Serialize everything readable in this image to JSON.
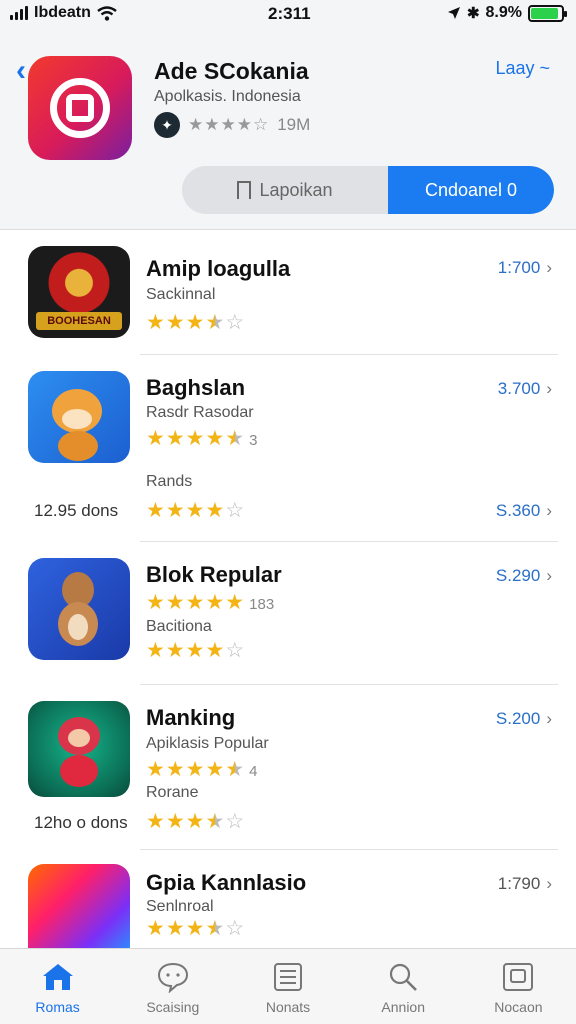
{
  "status": {
    "carrier": "Ibdeatn",
    "time": "2:311",
    "battery": "8.9%",
    "battery_level": 0.9
  },
  "header": {
    "app_name": "Ade SCokania",
    "subtitle": "Apolkasis. Indonesia",
    "size": "19M",
    "language_link": "Laay ~",
    "report_label": "Lapoikan",
    "download_label": "Cndoanel 0"
  },
  "apps": [
    {
      "name": "Amip loagulla",
      "sub": "Sackinnal",
      "rating": 3.5,
      "count": "",
      "price": "1:700"
    },
    {
      "name": "Baghslan",
      "sub": "Rasdr Rasodar",
      "rating": 4.5,
      "count": "3",
      "price": "3.700"
    },
    {
      "name": "",
      "sub": "Rands",
      "rating": 4,
      "count": "",
      "price": "S.360",
      "note": "12.95 dons"
    },
    {
      "name": "Blok Repular",
      "sub": "",
      "rating": 5,
      "count": "183",
      "price": "S.290"
    },
    {
      "name": "",
      "sub": "Bacitiona",
      "rating": 4,
      "count": "",
      "price": ""
    },
    {
      "name": "Manking",
      "sub": "Apiklasis Popular",
      "rating": 4.5,
      "count": "4",
      "price": "S.200"
    },
    {
      "name": "",
      "sub": "Rorane",
      "rating": 3.5,
      "count": "",
      "price": "",
      "note": "12ho o dons"
    },
    {
      "name": "Gpia Kannlasio",
      "sub": "Senlnroal",
      "rating": 3.5,
      "count": "",
      "price": "1:790"
    }
  ],
  "tabs": [
    {
      "label": "Romas",
      "icon": "home-icon",
      "active": true
    },
    {
      "label": "Scaising",
      "icon": "chat-icon",
      "active": false
    },
    {
      "label": "Nonats",
      "icon": "list-icon",
      "active": false
    },
    {
      "label": "Annion",
      "icon": "search-icon",
      "active": false
    },
    {
      "label": "Nocaon",
      "icon": "tablet-icon",
      "active": false
    }
  ],
  "colors": {
    "accent": "#1a7cf0",
    "link": "#1a73e8",
    "star": "#f3b416",
    "header_bg": "#f4f5f7"
  }
}
